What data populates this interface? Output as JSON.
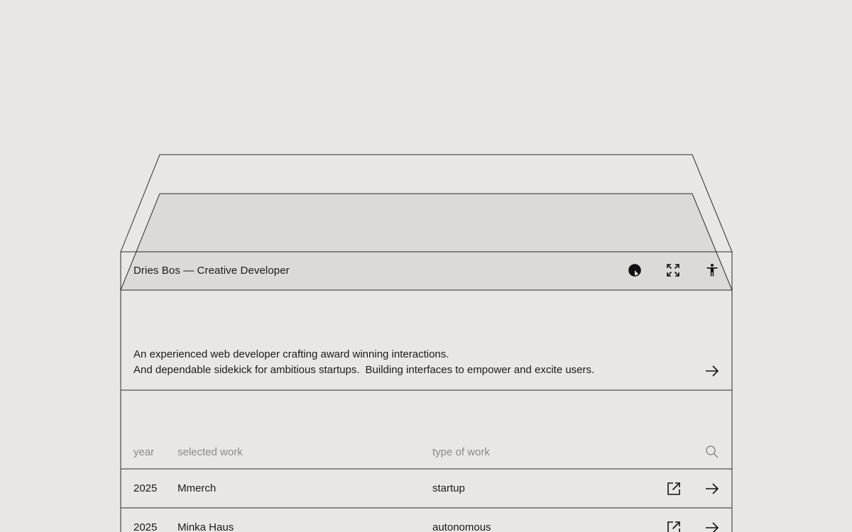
{
  "header": {
    "title": "Dries Bos — Creative Developer",
    "icons": [
      "contrast-icon",
      "fullscreen-icon",
      "accessibility-icon"
    ]
  },
  "intro": {
    "line1": "An experienced web developer crafting award winning interactions.",
    "line2a": "And dependable sidekick for ambitious startups.",
    "line2b": "Building interfaces to empower and excite users."
  },
  "work_table": {
    "columns": {
      "year": "year",
      "work": "selected work",
      "type": "type of work"
    },
    "rows": [
      {
        "year": "2025",
        "work": "Mmerch",
        "type": "startup"
      },
      {
        "year": "2025",
        "work": "Minka Haus",
        "type": "autonomous"
      }
    ]
  },
  "colors": {
    "background": "#e9e7e3",
    "header_fill": "#dcdad6",
    "line": "#2b2b2b",
    "muted_text": "#8a8a87"
  }
}
